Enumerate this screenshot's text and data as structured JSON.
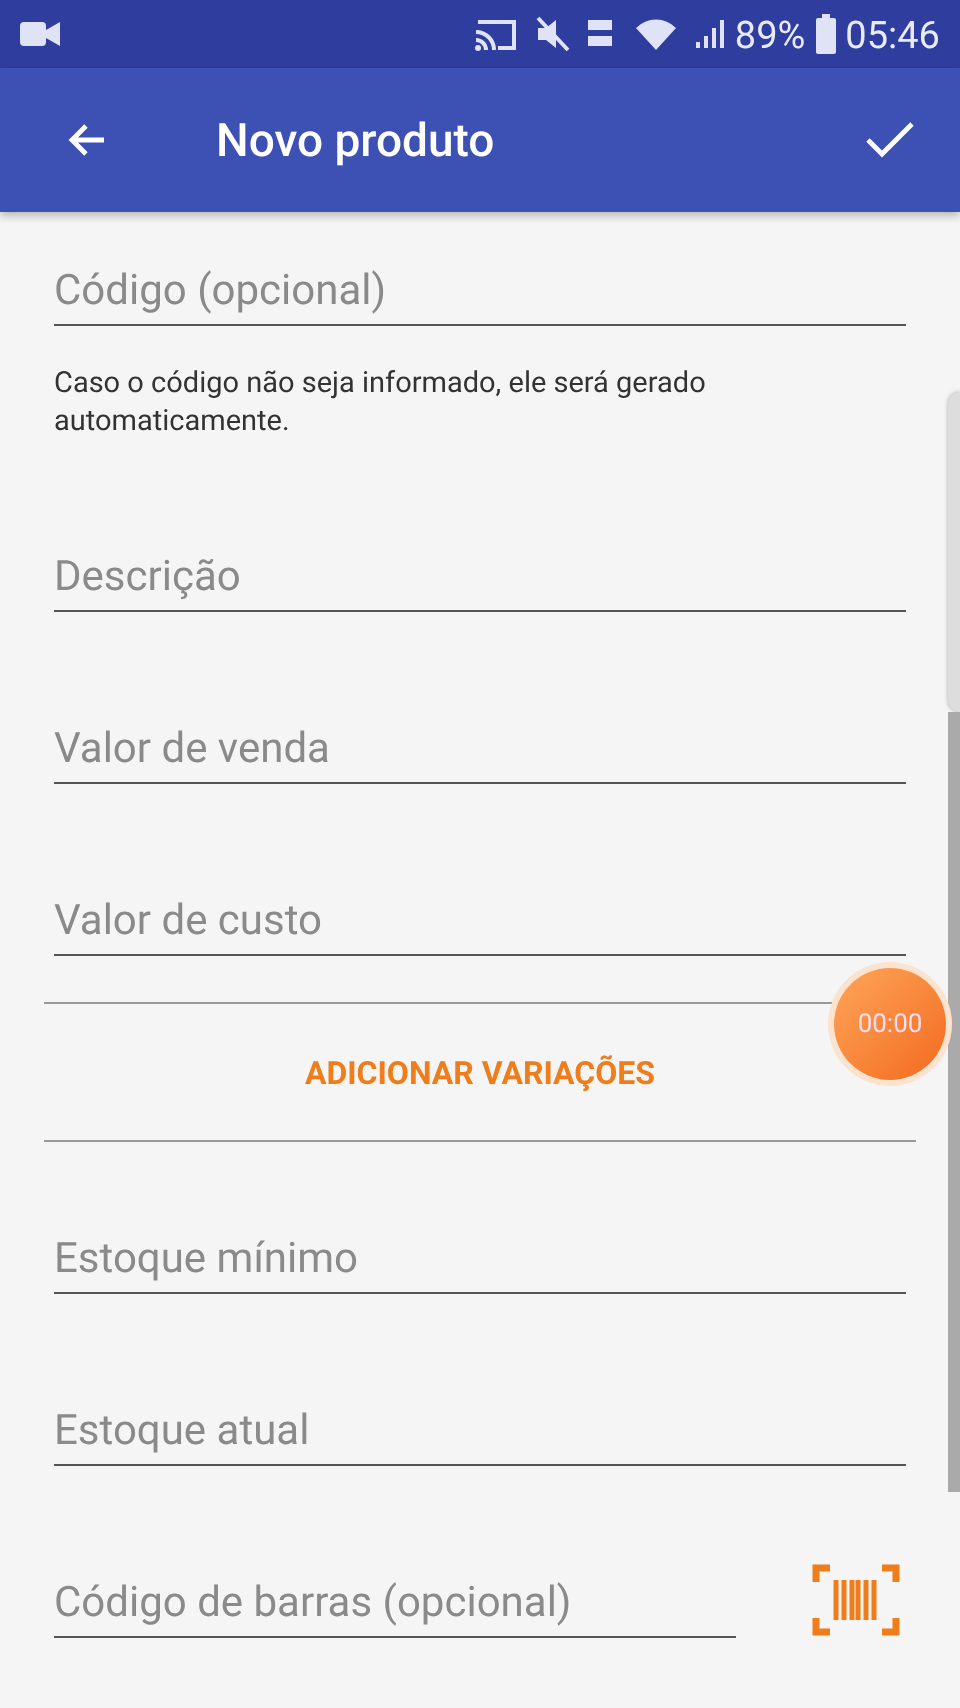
{
  "status_bar": {
    "battery": "89%",
    "time": "05:46"
  },
  "app_bar": {
    "title": "Novo produto"
  },
  "form": [
    {
      "kind": "field",
      "placeholder": "Código (opcional)"
    },
    {
      "kind": "hint",
      "text": "Caso o código não seja informado, ele será gerado automaticamente."
    },
    {
      "kind": "field",
      "placeholder": "Descrição"
    },
    {
      "kind": "field",
      "placeholder": "Valor de venda"
    },
    {
      "kind": "field",
      "placeholder": "Valor de custo"
    },
    {
      "kind": "button",
      "label": "ADICIONAR VARIAÇÕES"
    },
    {
      "kind": "field",
      "placeholder": "Estoque mínimo"
    },
    {
      "kind": "field",
      "placeholder": "Estoque atual"
    },
    {
      "kind": "barcode-field",
      "placeholder": "Código de barras (opcional)"
    }
  ],
  "recorder_bubble": {
    "time": "00:00"
  }
}
